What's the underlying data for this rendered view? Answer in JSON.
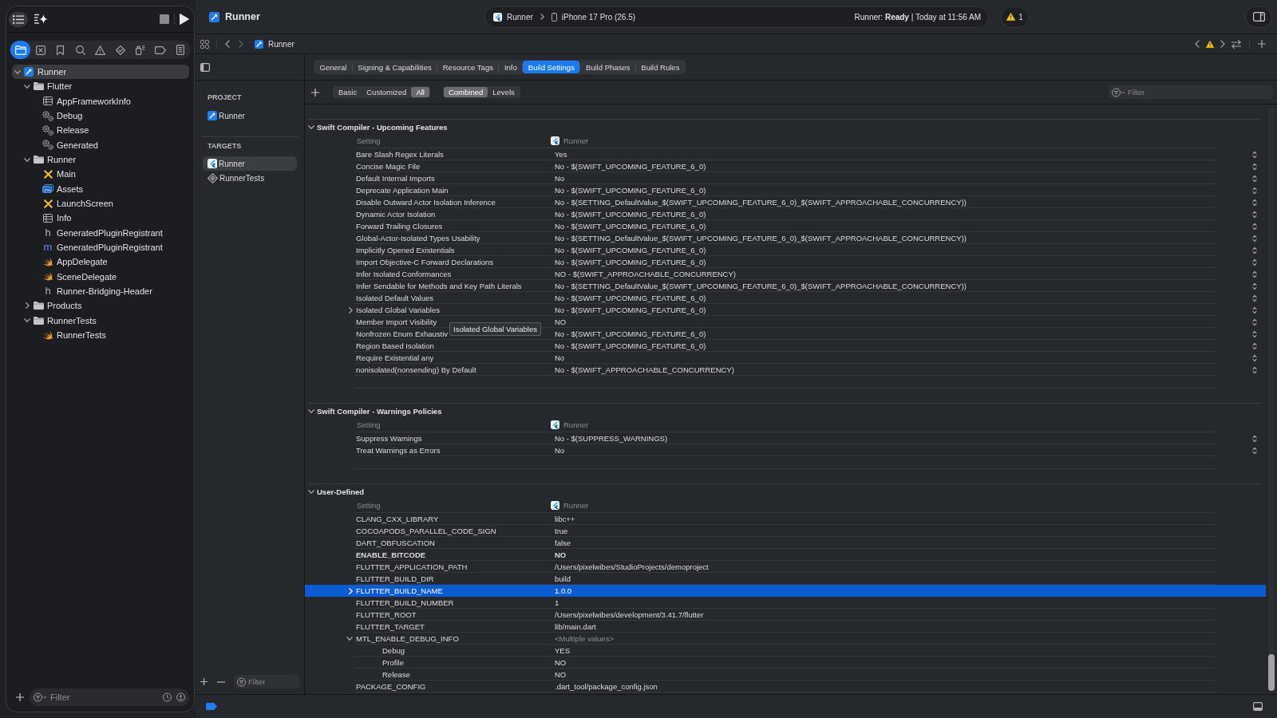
{
  "toolbar": {
    "title": "Runner",
    "scheme": "Runner",
    "destination": "iPhone 17 Pro (26.5)",
    "status": "Runner: **Ready** | Today at 11:56 AM",
    "warnings": "1"
  },
  "navigator": {
    "tabs": [
      {
        "kind": "project",
        "selected": true
      },
      {
        "kind": "source-control",
        "selected": false
      },
      {
        "kind": "bookmarks",
        "selected": false
      },
      {
        "kind": "find",
        "selected": false
      },
      {
        "kind": "issues",
        "selected": false
      },
      {
        "kind": "tests",
        "selected": false
      },
      {
        "kind": "debug",
        "selected": false
      },
      {
        "kind": "breakpoints",
        "selected": false
      },
      {
        "kind": "reports",
        "selected": false
      }
    ],
    "tree": [
      {
        "label": "Runner",
        "kind": "project",
        "expanded": true,
        "selected": true,
        "children": [
          {
            "label": "Flutter",
            "kind": "group",
            "expanded": true,
            "selected": false,
            "children": [
              {
                "label": "AppFrameworkInfo",
                "kind": "plist",
                "selected": false
              },
              {
                "label": "Debug",
                "kind": "xcconfig",
                "selected": false
              },
              {
                "label": "Release",
                "kind": "xcconfig",
                "selected": false
              },
              {
                "label": "Generated",
                "kind": "xcconfig",
                "selected": false
              }
            ]
          },
          {
            "label": "Runner",
            "kind": "group",
            "expanded": true,
            "selected": false,
            "children": [
              {
                "label": "Main",
                "kind": "storyboard",
                "selected": false
              },
              {
                "label": "Assets",
                "kind": "assets",
                "selected": false
              },
              {
                "label": "LaunchScreen",
                "kind": "storyboard",
                "selected": false
              },
              {
                "label": "Info",
                "kind": "plist",
                "selected": false
              },
              {
                "label": "GeneratedPluginRegistrant",
                "kind": "header",
                "letter": "h",
                "selected": false
              },
              {
                "label": "GeneratedPluginRegistrant",
                "kind": "implementation",
                "letter": "m",
                "selected": false
              },
              {
                "label": "AppDelegate",
                "kind": "swift",
                "selected": false
              },
              {
                "label": "SceneDelegate",
                "kind": "swift",
                "selected": false
              },
              {
                "label": "Runner-Bridging-Header",
                "kind": "header",
                "letter": "h",
                "selected": false
              }
            ]
          },
          {
            "label": "Products",
            "kind": "group",
            "expanded": false,
            "selected": false
          },
          {
            "label": "RunnerTests",
            "kind": "group",
            "expanded": true,
            "selected": false,
            "children": [
              {
                "label": "RunnerTests",
                "kind": "swift",
                "selected": false
              }
            ]
          }
        ]
      }
    ],
    "filter": {
      "placeholder": "Filter"
    }
  },
  "jump_bar": {
    "path": [
      "Runner"
    ]
  },
  "editor_tabs": [
    {
      "label": "General",
      "selected": false
    },
    {
      "label": "Signing & Capabilities",
      "selected": false
    },
    {
      "label": "Resource Tags",
      "selected": false
    },
    {
      "label": "Info",
      "selected": false
    },
    {
      "label": "Build Settings",
      "selected": true
    },
    {
      "label": "Build Phases",
      "selected": false
    },
    {
      "label": "Build Rules",
      "selected": false
    }
  ],
  "targets_list": {
    "sections": [
      {
        "title": "PROJECT",
        "items": [
          {
            "label": "Runner",
            "kind": "project",
            "selected": false
          }
        ]
      },
      {
        "title": "TARGETS",
        "items": [
          {
            "label": "Runner",
            "kind": "app",
            "selected": true
          },
          {
            "label": "RunnerTests",
            "kind": "tests",
            "selected": false
          }
        ]
      }
    ],
    "filter": {
      "placeholder": "Filter"
    }
  },
  "build_settings": {
    "scopes": [
      {
        "label": "Basic",
        "selected": false
      },
      {
        "label": "Customized",
        "selected": false
      },
      {
        "label": "All",
        "selected": true
      }
    ],
    "views": [
      {
        "label": "Combined",
        "selected": true
      },
      {
        "label": "Levels",
        "selected": false
      }
    ],
    "filter": {
      "placeholder": "Filter"
    },
    "sections": [
      {
        "title": "Swift Compiler - Upcoming Features",
        "expanded": true,
        "columns": [
          "Setting",
          "Runner"
        ],
        "rows": [
          {
            "name": "Bare Slash Regex Literals",
            "value": "Yes",
            "kind": "popup",
            "customized": false,
            "selected": false
          },
          {
            "name": "Concise Magic File",
            "value": "No - $(SWIFT_UPCOMING_FEATURE_6_0)",
            "kind": "popup",
            "customized": false,
            "selected": false
          },
          {
            "name": "Default Internal Imports",
            "value": "No",
            "kind": "popup",
            "customized": false,
            "selected": false
          },
          {
            "name": "Deprecate Application Main",
            "value": "No - $(SWIFT_UPCOMING_FEATURE_6_0)",
            "kind": "popup",
            "customized": false,
            "selected": false
          },
          {
            "name": "Disable Outward Actor Isolation Inference",
            "value": "No - $(SETTING_DefaultValue_$(SWIFT_UPCOMING_FEATURE_6_0)_$(SWIFT_APPROACHABLE_CONCURRENCY))",
            "kind": "popup",
            "customized": false,
            "selected": false
          },
          {
            "name": "Dynamic Actor Isolation",
            "value": "No - $(SWIFT_UPCOMING_FEATURE_6_0)",
            "kind": "popup",
            "customized": false,
            "selected": false
          },
          {
            "name": "Forward Trailing Closures",
            "value": "No - $(SWIFT_UPCOMING_FEATURE_6_0)",
            "kind": "popup",
            "customized": false,
            "selected": false
          },
          {
            "name": "Global-Actor-Isolated Types Usability",
            "value": "No - $(SETTING_DefaultValue_$(SWIFT_UPCOMING_FEATURE_6_0)_$(SWIFT_APPROACHABLE_CONCURRENCY))",
            "kind": "popup",
            "customized": false,
            "selected": false
          },
          {
            "name": "Implicitly Opened Existentials",
            "value": "No - $(SWIFT_UPCOMING_FEATURE_6_0)",
            "kind": "popup",
            "customized": false,
            "selected": false
          },
          {
            "name": "Import Objective-C Forward Declarations",
            "value": "No - $(SWIFT_UPCOMING_FEATURE_6_0)",
            "kind": "popup",
            "customized": false,
            "selected": false
          },
          {
            "name": "Infer Isolated Conformances",
            "value": "NO - $(SWIFT_APPROACHABLE_CONCURRENCY)",
            "kind": "popup",
            "customized": false,
            "selected": false
          },
          {
            "name": "Infer Sendable for Methods and Key Path Literals",
            "value": "No - $(SETTING_DefaultValue_$(SWIFT_UPCOMING_FEATURE_6_0)_$(SWIFT_APPROACHABLE_CONCURRENCY))",
            "kind": "popup",
            "customized": false,
            "selected": false
          },
          {
            "name": "Isolated Default Values",
            "value": "No - $(SWIFT_UPCOMING_FEATURE_6_0)",
            "kind": "popup",
            "customized": false,
            "selected": false
          },
          {
            "name": "Isolated Global Variables",
            "value": "No - $(SWIFT_UPCOMING_FEATURE_6_0)",
            "kind": "popup",
            "customized": false,
            "selected": false,
            "expanded": false
          },
          {
            "name": "Member Import Visibility",
            "value": "NO",
            "kind": "popup",
            "customized": false,
            "selected": false
          },
          {
            "name": "Nonfrozen Enum Exhaustiv",
            "value": "No - $(SWIFT_UPCOMING_FEATURE_6_0)",
            "kind": "popup",
            "customized": false,
            "selected": false
          },
          {
            "name": "Region Based Isolation",
            "value": "No - $(SWIFT_UPCOMING_FEATURE_6_0)",
            "kind": "popup",
            "customized": false,
            "selected": false
          },
          {
            "name": "Require Existential any",
            "value": "No",
            "kind": "popup",
            "customized": false,
            "selected": false
          },
          {
            "name": "nonisolated(nonsending) By Default",
            "value": "No - $(SWIFT_APPROACHABLE_CONCURRENCY)",
            "kind": "popup",
            "customized": false,
            "selected": false
          }
        ]
      },
      {
        "title": "Swift Compiler - Warnings Policies",
        "expanded": true,
        "columns": [
          "Setting",
          "Runner"
        ],
        "rows": [
          {
            "name": "Suppress Warnings",
            "value": "No - $(SUPPRESS_WARNINGS)",
            "kind": "popup",
            "customized": false,
            "selected": false
          },
          {
            "name": "Treat Warnings as Errors",
            "value": "No",
            "kind": "popup",
            "customized": false,
            "selected": false
          }
        ]
      },
      {
        "title": "User-Defined",
        "expanded": true,
        "columns": [
          "Setting",
          "Runner"
        ],
        "rows": [
          {
            "name": "CLANG_CXX_LIBRARY",
            "value": "libc++",
            "kind": "text",
            "customized": false,
            "selected": false
          },
          {
            "name": "COCOAPODS_PARALLEL_CODE_SIGN",
            "value": "true",
            "kind": "text",
            "customized": false,
            "selected": false
          },
          {
            "name": "DART_OBFUSCATION",
            "value": "false",
            "kind": "text",
            "customized": false,
            "selected": false
          },
          {
            "name": "ENABLE_BITCODE",
            "value": "NO",
            "kind": "text",
            "customized": true,
            "selected": false
          },
          {
            "name": "FLUTTER_APPLICATION_PATH",
            "value": "/Users/pixelwibes/StudioProjects/demoproject",
            "kind": "text",
            "customized": false,
            "selected": false
          },
          {
            "name": "FLUTTER_BUILD_DIR",
            "value": "build",
            "kind": "text",
            "customized": false,
            "selected": false
          },
          {
            "name": "FLUTTER_BUILD_NAME",
            "value": "1.0.0",
            "kind": "text",
            "customized": false,
            "selected": true,
            "expanded": false
          },
          {
            "name": "FLUTTER_BUILD_NUMBER",
            "value": "1",
            "kind": "text",
            "customized": false,
            "selected": false
          },
          {
            "name": "FLUTTER_ROOT",
            "value": "/Users/pixelwibes/development/3.41.7/flutter",
            "kind": "text",
            "customized": false,
            "selected": false
          },
          {
            "name": "FLUTTER_TARGET",
            "value": "lib/main.dart",
            "kind": "text",
            "customized": false,
            "selected": false
          },
          {
            "name": "MTL_ENABLE_DEBUG_INFO",
            "value": "<Multiple values>",
            "kind": "multiple",
            "customized": false,
            "selected": false,
            "expanded": true,
            "children": [
              {
                "name": "Debug",
                "value": "YES",
                "kind": "text",
                "customized": false,
                "selected": false
              },
              {
                "name": "Profile",
                "value": "NO",
                "kind": "text",
                "customized": false,
                "selected": false
              },
              {
                "name": "Release",
                "value": "NO",
                "kind": "text",
                "customized": false,
                "selected": false
              }
            ]
          },
          {
            "name": "PACKAGE_CONFIG",
            "value": ".dart_tool/package_config.json",
            "kind": "text",
            "customized": false,
            "selected": false
          }
        ]
      }
    ],
    "tooltip": "Isolated Global Variables"
  }
}
